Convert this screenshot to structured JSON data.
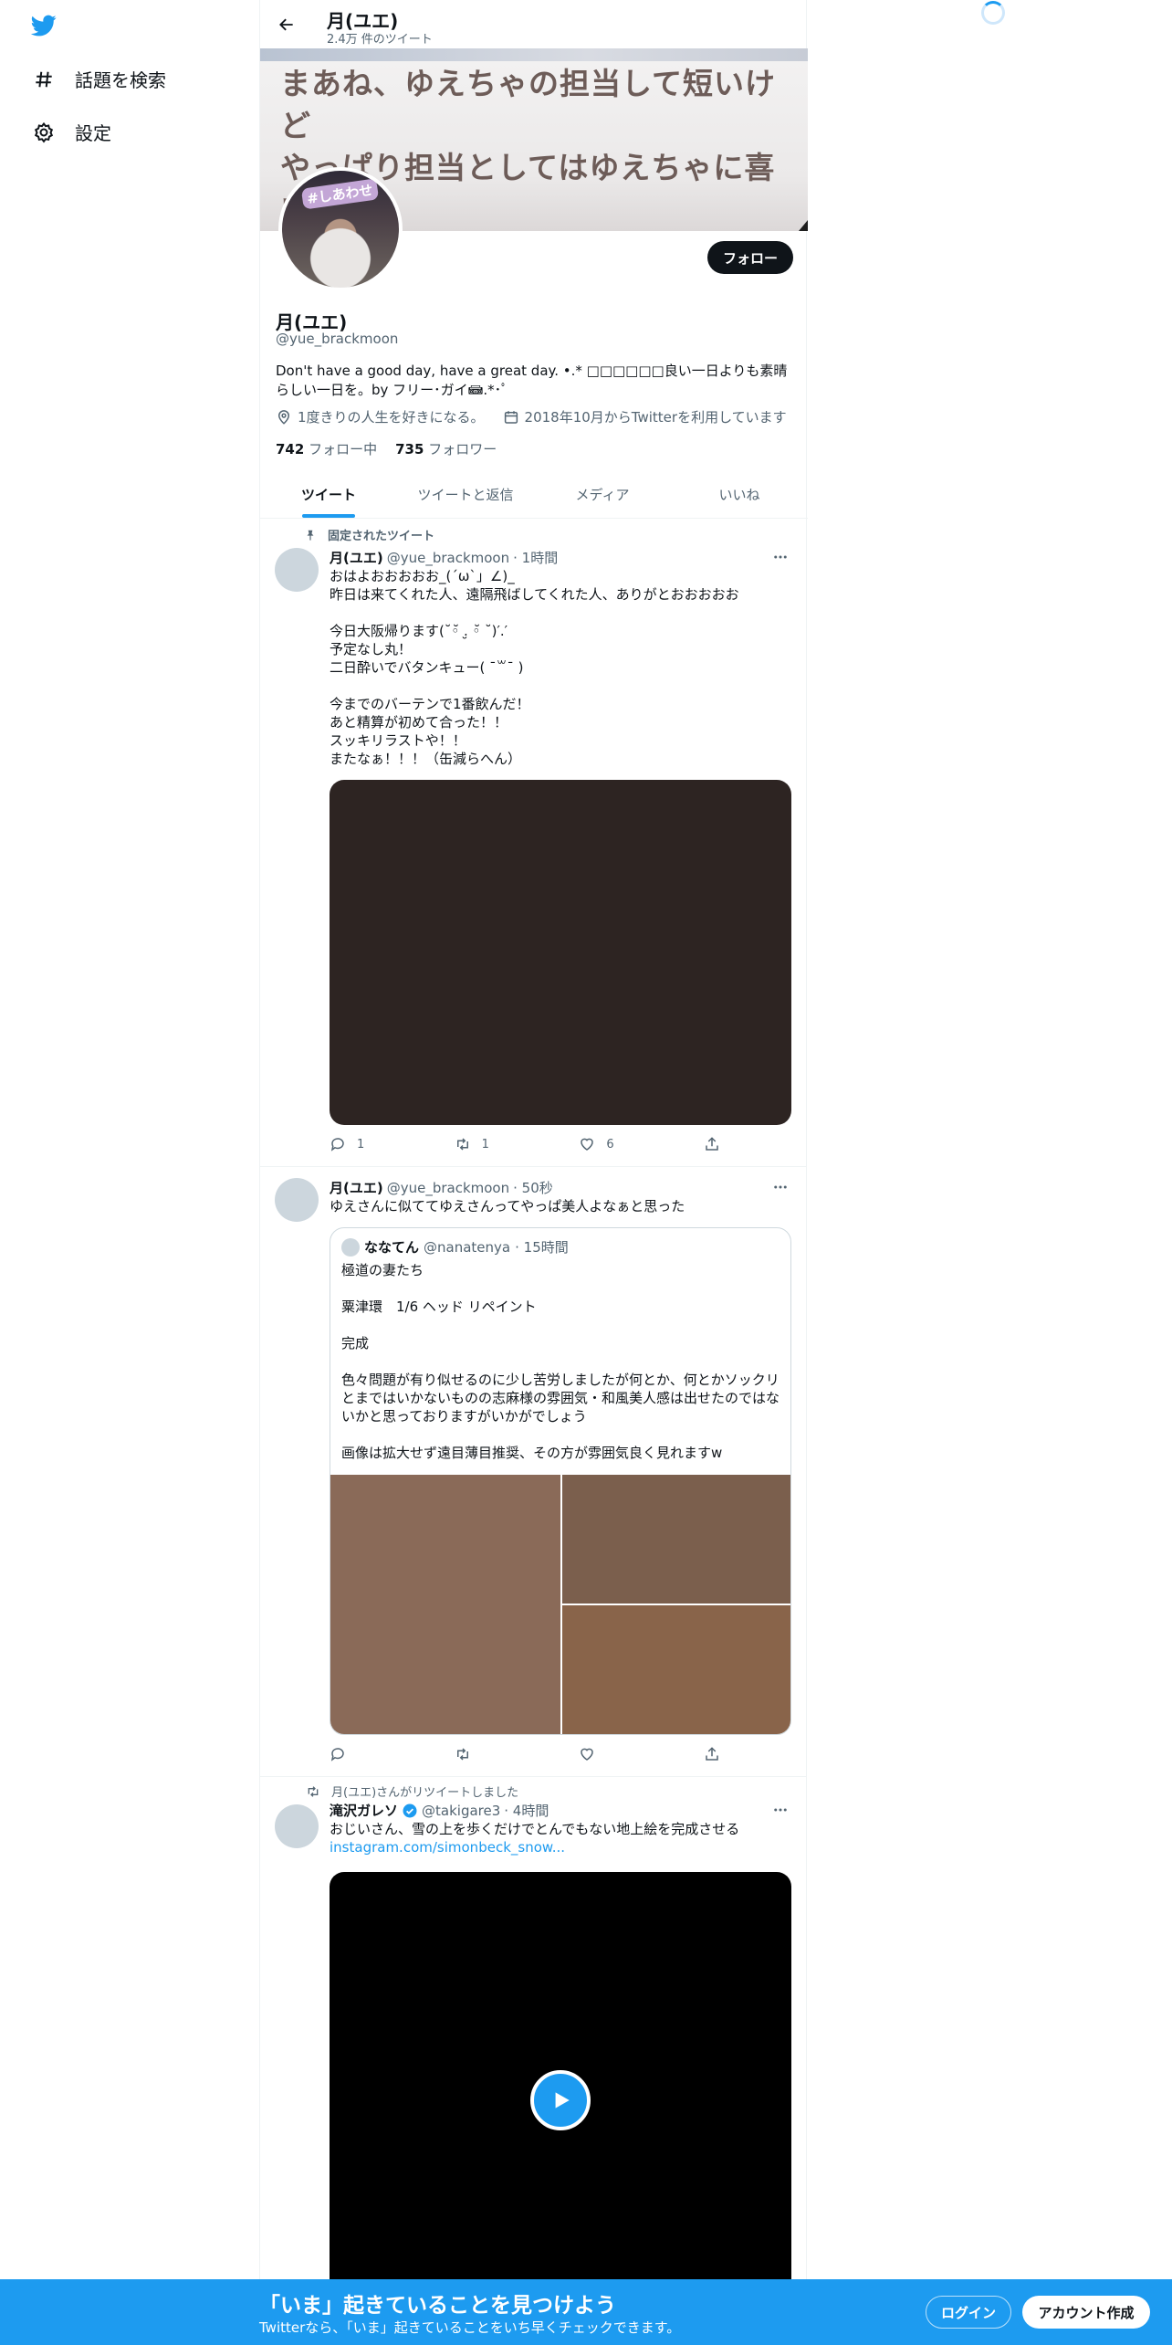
{
  "nav": {
    "items": [
      {
        "icon": "hashtag-icon",
        "label": "話題を検索"
      },
      {
        "icon": "gear-icon",
        "label": "設定"
      }
    ]
  },
  "topbar": {
    "title": "月(ユエ)",
    "subtitle": "2.4万 件のツイート"
  },
  "banner": {
    "text": "まあね、ゆえちゃの担当して短いけど\nやっぱり担当としてはゆえちゃに喜いしし"
  },
  "avatar": {
    "sticker": "#しあわせ"
  },
  "profile": {
    "follow_label": "フォロー",
    "name": "月(ユエ)",
    "handle": "@yue_brackmoon",
    "bio": "Don't have a good day, have a great day. •.* □□□□□□良い一日よりも素晴らしい一日を。by フリー･ガイ📾.*･ﾟ",
    "location": "1度きりの人生を好きになる。",
    "joined": "2018年10月からTwitterを利用しています",
    "following_count": "742",
    "following_label": "フォロー中",
    "followers_count": "735",
    "followers_label": "フォロワー"
  },
  "tabs": [
    "ツイート",
    "ツイートと返信",
    "メディア",
    "いいね"
  ],
  "tweets": [
    {
      "social": "固定されたツイート",
      "name": "月(ユエ)",
      "handle": "@yue_brackmoon",
      "time": "· 1時間",
      "text": "おはよおおおおお_(´ω`」∠)_\n昨日は来てくれた人、遠隔飛ばしてくれた人、ありがとおおおおお\n\n今日大阪帰ります(˘◦̆ .̮ ◦̆ ˘)′.′\n予定なし丸！\n二日酔いでバタンキュー( ¯꒳¯ )\n\n今までのバーテンで1番飲んだ！\nあと精算が初めて合った！！\nスッキリラストや！！\nまたなぁ！！！（缶減らへん）",
      "reply": "1",
      "retweet": "1",
      "like": "6"
    },
    {
      "name": "月(ユエ)",
      "handle": "@yue_brackmoon",
      "time": "· 50秒",
      "text": "ゆえさんに似ててゆえさんってやっぱ美人よなぁと思った",
      "quote": {
        "name": "ななてん",
        "handle": "@nanatenya",
        "time": "· 15時間",
        "text": "極道の妻たち\n\n粟津環　1/6 ヘッド リペイント\n\n完成\n\n色々問題が有り似せるのに少し苦労しましたが何とか、何とかソックリとまではいかないものの志麻様の雰囲気・和風美人感は出せたのではないかと思っておりますがいかがでしょう\n\n画像は拡大せず遠目薄目推奨、その方が雰囲気良く見れますw"
      }
    },
    {
      "social": "月(ユエ)さんがリツイートしました",
      "name": "滝沢ガレソ",
      "handle": "@takigare3",
      "time": "· 4時間",
      "text": "おじいさん、雪の上を歩くだけでとんでもない地上絵を完成させる",
      "link": "instagram.com/simonbeck_snow..."
    }
  ],
  "bottom": {
    "title": "「いま」起きていることを見つけよう",
    "subtitle": "Twitterなら、「いま」起きていることをいち早くチェックできます。",
    "login": "ログイン",
    "signup": "アカウント作成"
  },
  "colors": {
    "accent": "#1d9bf0",
    "text": "#0f1419",
    "muted": "#536471"
  }
}
